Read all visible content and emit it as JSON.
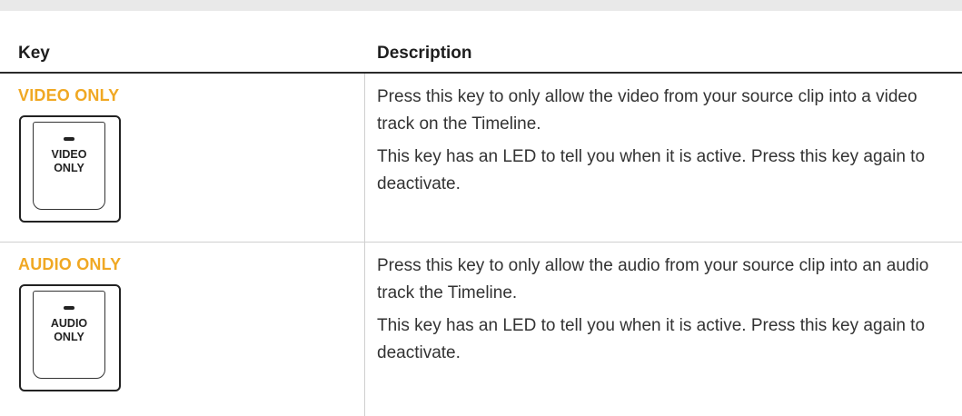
{
  "table": {
    "headers": {
      "key": "Key",
      "description": "Description"
    },
    "rows": [
      {
        "key_name": "VIDEO ONLY",
        "keycap_label": "VIDEO\nONLY",
        "description": [
          "Press this key to only allow the video from your source clip into a video track on the Timeline.",
          "This key has an LED to tell you when it is active. Press this key again to deactivate."
        ]
      },
      {
        "key_name": "AUDIO ONLY",
        "keycap_label": "AUDIO\nONLY",
        "description": [
          "Press this key to only allow the audio from your source clip into an audio track the Timeline.",
          "This key has an LED to tell you when it is active. Press this key again to deactivate."
        ]
      }
    ]
  },
  "colors": {
    "key_name": "#f0a823",
    "header_rule": "#2a2a2a",
    "divider": "#cfcfcf"
  }
}
